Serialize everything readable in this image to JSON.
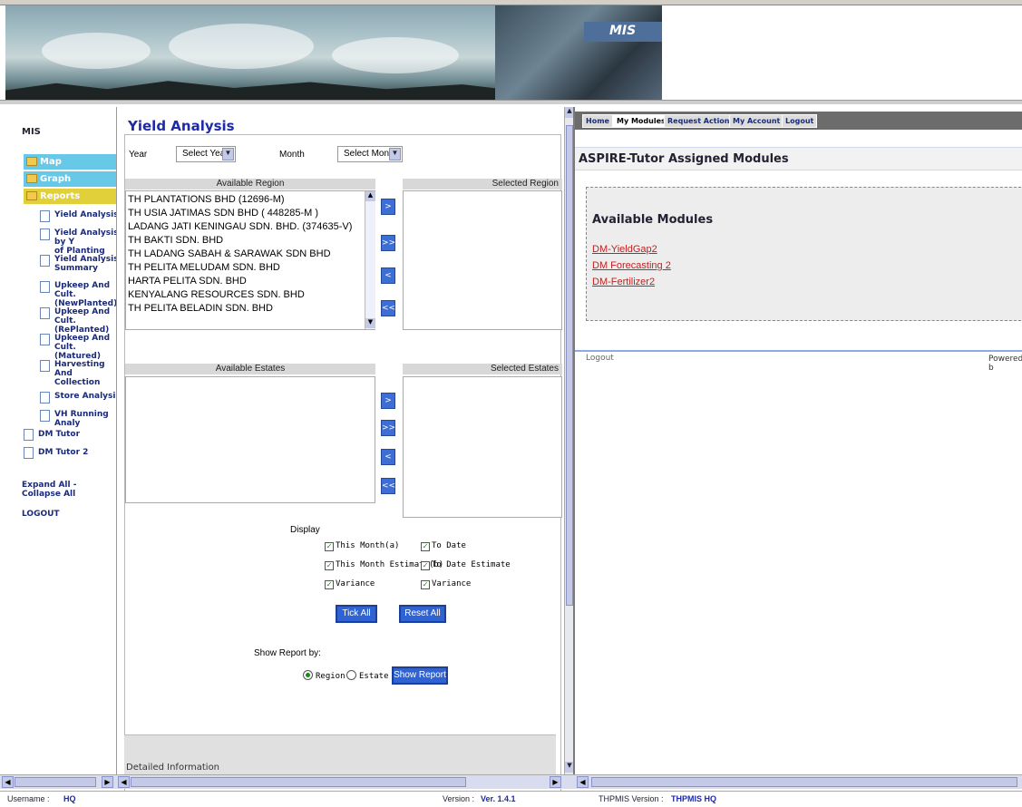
{
  "banner": {
    "tag": "MIS"
  },
  "sidebar": {
    "title": "MIS",
    "folders": [
      "Map",
      "Graph",
      "Reports"
    ],
    "report_items": [
      [
        "Yield Analysis"
      ],
      [
        "Yield Analysis by Y",
        "of Planting"
      ],
      [
        "Yield Analysis",
        "Summary"
      ],
      [
        "Upkeep And Cult.",
        "(NewPlanted)"
      ],
      [
        "Upkeep And Cult.",
        "(RePlanted)"
      ],
      [
        "Upkeep And Cult.",
        "(Matured)"
      ],
      [
        "Harvesting And",
        "Collection"
      ],
      [
        "Store Analysis"
      ],
      [
        "VH Running Analy"
      ]
    ],
    "roots": [
      "DM Tutor",
      "DM Tutor 2"
    ],
    "expand_collapse": "Expand All - Collapse All",
    "logout": "LOGOUT"
  },
  "yield": {
    "title": "Yield Analysis",
    "year_label": "Year",
    "year_select": "Select Year",
    "month_label": "Month",
    "month_select": "Select Month",
    "available_region": "Available Region",
    "selected_region": "Selected Region",
    "regions": [
      "TH PLANTATIONS BHD (12696-M)",
      "TH USIA JATIMAS SDN BHD ( 448285-M )",
      "LADANG JATI KENINGAU SDN. BHD. (374635-V)",
      "TH BAKTI SDN. BHD",
      "TH LADANG SABAH & SARAWAK SDN BHD",
      "TH PELITA MELUDAM SDN. BHD",
      "HARTA PELITA SDN. BHD",
      "KENYALANG RESOURCES SDN. BHD",
      "TH PELITA BELADIN SDN. BHD"
    ],
    "available_estates": "Available Estates",
    "selected_estates": "Selected Estates",
    "move_buttons": [
      ">",
      ">>",
      "<",
      "<<"
    ],
    "display_label": "Display",
    "checks_left": [
      "This Month(a)",
      "This Month Estimate(b)",
      "Variance"
    ],
    "checks_right": [
      "To Date",
      "To Date Estimate",
      "Variance"
    ],
    "tick_all": "Tick All",
    "reset_all": "Reset All",
    "show_by_label": "Show Report by:",
    "radio_region": "Region",
    "radio_estate": "Estate",
    "show_report": "Show Report",
    "detail_label": "Detailed Information"
  },
  "right": {
    "tabs": [
      "Home",
      "My Modules",
      "Request Action",
      "My Account",
      "Logout"
    ],
    "active_tab": "My Modules",
    "heading": "ASPIRE-Tutor Assigned Modules",
    "available_modules": "Available Modules",
    "modules": [
      "DM-YieldGap2",
      "DM Forecasting 2",
      "DM-Fertilizer2"
    ],
    "logout": "Logout",
    "powered": "Powered b"
  },
  "status": {
    "username_label": "Username :",
    "username": "HQ",
    "version_label": "Version :",
    "version": "Ver. 1.4.1",
    "thpmis_label": "THPMIS Version :",
    "thpmis": "THPMIS HQ"
  }
}
